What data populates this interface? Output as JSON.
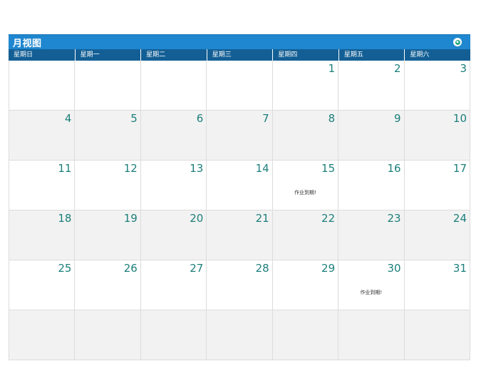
{
  "calendar": {
    "title": "月视图",
    "weekdays": [
      "星期日",
      "星期一",
      "星期二",
      "星期三",
      "星期四",
      "星期五",
      "星期六"
    ],
    "weeks": [
      [
        {
          "day": ""
        },
        {
          "day": ""
        },
        {
          "day": ""
        },
        {
          "day": ""
        },
        {
          "day": "1"
        },
        {
          "day": "2"
        },
        {
          "day": "3"
        }
      ],
      [
        {
          "day": "4"
        },
        {
          "day": "5"
        },
        {
          "day": "6"
        },
        {
          "day": "7"
        },
        {
          "day": "8"
        },
        {
          "day": "9"
        },
        {
          "day": "10"
        }
      ],
      [
        {
          "day": "11"
        },
        {
          "day": "12"
        },
        {
          "day": "13"
        },
        {
          "day": "14"
        },
        {
          "day": "15",
          "note": "作业到期!"
        },
        {
          "day": "16"
        },
        {
          "day": "17"
        }
      ],
      [
        {
          "day": "18"
        },
        {
          "day": "19"
        },
        {
          "day": "20"
        },
        {
          "day": "21"
        },
        {
          "day": "22"
        },
        {
          "day": "23"
        },
        {
          "day": "24"
        }
      ],
      [
        {
          "day": "25"
        },
        {
          "day": "26"
        },
        {
          "day": "27"
        },
        {
          "day": "28"
        },
        {
          "day": "29"
        },
        {
          "day": "30",
          "note": "作业到期!"
        },
        {
          "day": "31"
        }
      ],
      [
        {
          "day": ""
        },
        {
          "day": ""
        },
        {
          "day": ""
        },
        {
          "day": ""
        },
        {
          "day": ""
        },
        {
          "day": ""
        },
        {
          "day": ""
        }
      ]
    ]
  },
  "colors": {
    "title_bar": "#1f87cf",
    "weekday_bar": "#135f95",
    "day_number": "#1b7f7a",
    "shaded_row": "#f2f2f2",
    "icon_accent": "#2aa889"
  },
  "icons": {
    "title_icon": "app-badge-icon"
  }
}
